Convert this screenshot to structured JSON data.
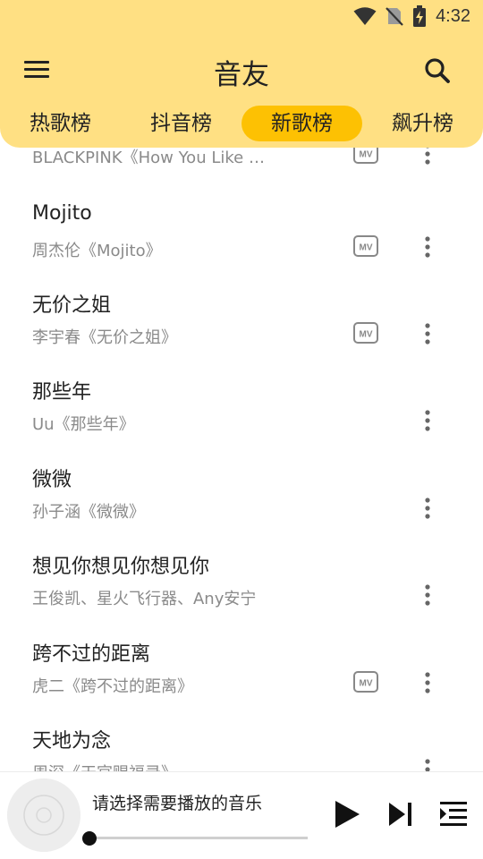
{
  "status": {
    "time": "4:32"
  },
  "header": {
    "title": "音友"
  },
  "tabs": [
    {
      "label": "热歌榜",
      "active": false
    },
    {
      "label": "抖音榜",
      "active": false
    },
    {
      "label": "新歌榜",
      "active": true
    },
    {
      "label": "飙升榜",
      "active": false
    }
  ],
  "songs": [
    {
      "title": "",
      "subtitle": "BLACKPINK《How You Like That》",
      "has_mv": true
    },
    {
      "title": "Mojito",
      "subtitle": "周杰伦《Mojito》",
      "has_mv": true
    },
    {
      "title": "无价之姐",
      "subtitle": "李宇春《无价之姐》",
      "has_mv": true
    },
    {
      "title": "那些年",
      "subtitle": "Uu《那些年》",
      "has_mv": false
    },
    {
      "title": "微微",
      "subtitle": "孙子涵《微微》",
      "has_mv": false
    },
    {
      "title": "想见你想见你想见你",
      "subtitle": "王俊凯、星火飞行器、Any安宁",
      "has_mv": false
    },
    {
      "title": "跨不过的距离",
      "subtitle": "虎二《跨不过的距离》",
      "has_mv": true
    },
    {
      "title": "天地为念",
      "subtitle": "周深《天官赐福录》",
      "has_mv": false
    }
  ],
  "player": {
    "text": "请选择需要播放的音乐",
    "progress": 0
  },
  "icons": {
    "menu": "menu-icon",
    "search": "search-icon",
    "mv": "mv-icon",
    "more": "more-vertical-icon",
    "play": "play-icon",
    "next": "skip-next-icon",
    "queue": "playlist-icon",
    "wifi": "wifi-icon",
    "no_sim": "no-sim-icon",
    "battery": "battery-charging-icon"
  },
  "colors": {
    "header_bg": "#FFE083",
    "tab_active": "#FDC103",
    "text": "#222222",
    "subtext": "#8A8A8A"
  }
}
